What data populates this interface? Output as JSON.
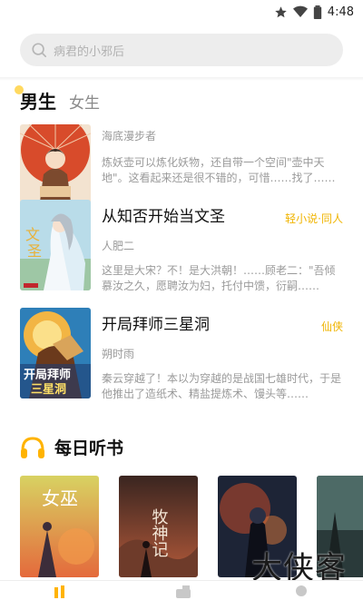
{
  "status": {
    "time": "4:48",
    "icons": [
      "star-icon",
      "wifi-icon",
      "battery-icon"
    ]
  },
  "search": {
    "placeholder": "病君的小邪后"
  },
  "tabs": {
    "active": "男生",
    "inactive": "女生"
  },
  "books": [
    {
      "title": "",
      "tag": "",
      "author": "海底漫步者",
      "desc": "炼妖壶可以炼化妖物，还自带一个空间\"壶中天地\"。这看起来还是很不错的，可惜……找了……"
    },
    {
      "title": "从知否开始当文圣",
      "tag": "轻小说·同人",
      "author": "人肥二",
      "desc": "这里是大宋？不！是大洪朝！……顾老二：\"吾倾慕汝之久，愿聘汝为妇，托付中馈，衍嗣……"
    },
    {
      "title": "开局拜师三星洞",
      "tag": "仙侠",
      "author": "朔时雨",
      "desc": "秦云穿越了！本以为穿越的是战国七雄时代，于是他推出了造纸术、精盐提炼术、馒头等……"
    }
  ],
  "daily": {
    "title": "每日听书"
  },
  "audio_books": [
    "女巫",
    "牧神记",
    "",
    ""
  ],
  "watermark": "大侠客",
  "bottom_nav": [
    "home-icon",
    "bookshelf-icon",
    "profile-icon"
  ],
  "colors": {
    "accent": "#f0b400",
    "headphone": "#ffb300"
  }
}
